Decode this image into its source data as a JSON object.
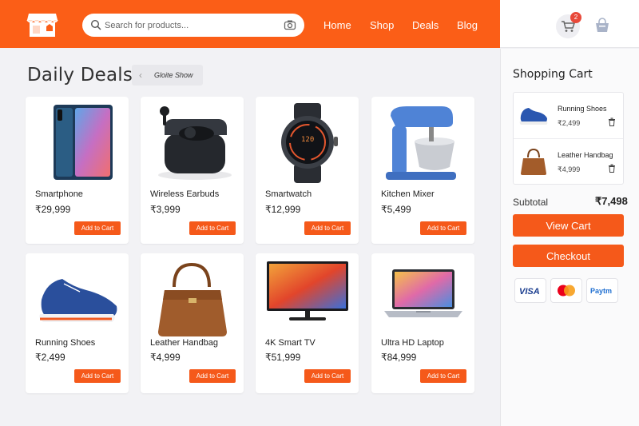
{
  "header": {
    "search_placeholder": "Search for products...",
    "nav": [
      "Home",
      "Shop",
      "Deals",
      "Blog"
    ],
    "cart_count": "2",
    "brand_color": "#fb5e17"
  },
  "main": {
    "title": "Daily Deals",
    "tag": "Gloite Show",
    "add_label": "Add to Cart",
    "products": [
      {
        "name": "Smartphone",
        "price": "₹29,999",
        "icon": "smartphone"
      },
      {
        "name": "Wireless Earbuds",
        "price": "₹3,999",
        "icon": "earbuds"
      },
      {
        "name": "Smartwatch",
        "price": "₹12,999",
        "icon": "smartwatch"
      },
      {
        "name": "Kitchen Mixer",
        "price": "₹5,499",
        "icon": "stand-mixer"
      },
      {
        "name": "Running Shoes",
        "price": "₹2,499",
        "icon": "sneaker"
      },
      {
        "name": "Leather Handbag",
        "price": "₹4,999",
        "icon": "handbag"
      },
      {
        "name": "4K Smart TV",
        "price": "₹51,999",
        "icon": "television"
      },
      {
        "name": "Ultra HD Laptop",
        "price": "₹84,999",
        "icon": "laptop"
      }
    ]
  },
  "cart": {
    "title": "Shopping Cart",
    "items": [
      {
        "name": "Running Shoes",
        "price": "₹2,499"
      },
      {
        "name": "Leather Handbag",
        "price": "₹4,999"
      }
    ],
    "subtotal_label": "Subtotal",
    "subtotal_value": "₹7,498",
    "view_cart": "View Cart",
    "checkout": "Checkout",
    "payments": [
      "VISA",
      "Mastercard",
      "Paytm"
    ]
  }
}
